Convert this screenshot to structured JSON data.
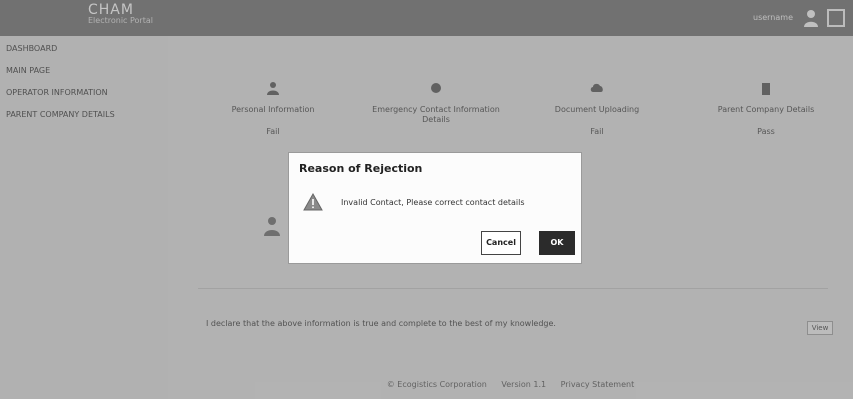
{
  "header": {
    "brand_title": "CHAM",
    "brand_subtitle": "Electronic Portal",
    "user_name": "username"
  },
  "sidebar": {
    "items": [
      {
        "label": "DASHBOARD"
      },
      {
        "label": "MAIN PAGE"
      },
      {
        "label": "OPERATOR INFORMATION"
      },
      {
        "label": "PARENT COMPANY DETAILS"
      }
    ]
  },
  "main": {
    "cards": [
      {
        "label": "Personal Information",
        "value": "Fail",
        "icon": "user-icon"
      },
      {
        "label": "Emergency Contact Information Details",
        "value": "",
        "icon": "phone-icon"
      },
      {
        "label": "Document Uploading",
        "value": "Fail",
        "icon": "cloud-upload-icon"
      },
      {
        "label": "Parent Company Details",
        "value": "Pass",
        "icon": "building-icon"
      }
    ],
    "declaration_text": "I declare that the above information is true and complete to the best of my knowledge.",
    "view_button": "View"
  },
  "footer": {
    "company": "© Ecogistics Corporation",
    "version": "Version 1.1",
    "privacy": "Privacy Statement"
  },
  "modal": {
    "title": "Reason of Rejection",
    "message": "Invalid Contact, Please correct contact details",
    "cancel_label": "Cancel",
    "ok_label": "OK",
    "icon": "warning-icon"
  },
  "colors": {
    "topbar": "#6e6e6e",
    "ok_button": "#2b2b2b",
    "modal_bg": "#fcfcfc"
  }
}
